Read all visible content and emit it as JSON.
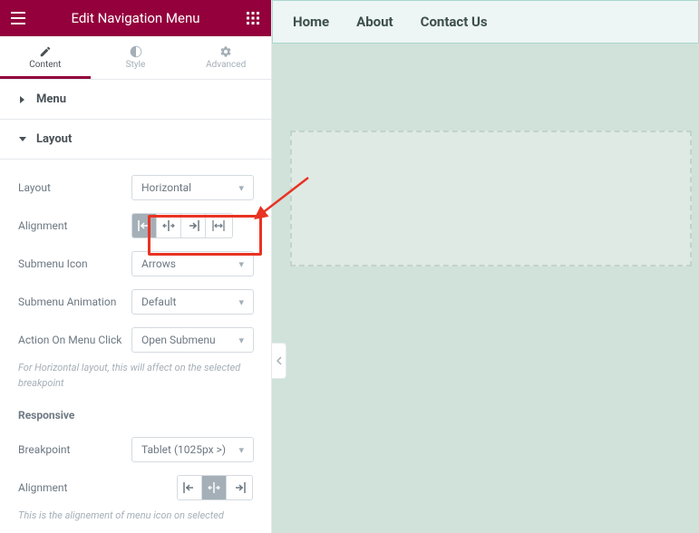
{
  "header": {
    "title": "Edit Navigation Menu"
  },
  "tabs": {
    "content": "Content",
    "style": "Style",
    "advanced": "Advanced"
  },
  "sections": {
    "menu": {
      "title": "Menu"
    },
    "layout": {
      "title": "Layout",
      "layout_label": "Layout",
      "layout_value": "Horizontal",
      "alignment_label": "Alignment",
      "submenu_icon_label": "Submenu Icon",
      "submenu_icon_value": "Arrows",
      "submenu_anim_label": "Submenu Animation",
      "submenu_anim_value": "Default",
      "action_label": "Action On Menu Click",
      "action_value": "Open Submenu",
      "action_desc": "For Horizontal layout, this will affect on the selected breakpoint",
      "responsive_head": "Responsive",
      "breakpoint_label": "Breakpoint",
      "breakpoint_value": "Tablet (1025px >)",
      "resp_align_label": "Alignment",
      "resp_align_desc": "This is the alignement of menu icon on selected"
    }
  },
  "preview": {
    "menu_items": [
      "Home",
      "About",
      "Contact Us"
    ]
  }
}
